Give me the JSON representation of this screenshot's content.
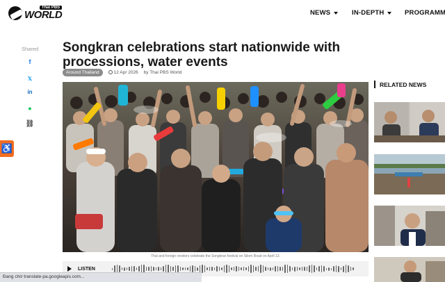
{
  "header": {
    "logo_top": "Thai PBS",
    "logo_bottom": "WORLD",
    "nav": [
      {
        "label": "NEWS",
        "dropdown": true
      },
      {
        "label": "IN-DEPTH",
        "dropdown": true
      },
      {
        "label": "PROGRAMME",
        "dropdown": false
      }
    ]
  },
  "share": {
    "label": "Shared",
    "buttons": [
      {
        "icon": "facebook-icon",
        "glyph": "f",
        "color": "#1877f2"
      },
      {
        "icon": "x-icon",
        "glyph": "𝕏",
        "color": "#111111"
      },
      {
        "icon": "linkedin-icon",
        "glyph": "in",
        "color": "#0a66c2"
      },
      {
        "icon": "line-icon",
        "glyph": "●",
        "color": "#06c755"
      },
      {
        "icon": "link-icon",
        "glyph": "⛓",
        "color": "#666666"
      }
    ]
  },
  "accessibility": {
    "icon": "accessibility-icon",
    "glyph": "♿",
    "color": "#f36d22"
  },
  "article": {
    "title": "Songkran celebrations start nationwide with processions, water events",
    "tag": "Around Thailand",
    "date": "12 Apr 2026",
    "byline": "by Thai PBS World",
    "caption": "Thai and foreign revelers celebrate the Songkran festival on Silom Road on April 13.",
    "listen_label": "LISTEN"
  },
  "related": {
    "heading": "RELATED NEWS"
  },
  "statusbar": {
    "text": "Đang chờ translate-pa.googleapis.com..."
  }
}
